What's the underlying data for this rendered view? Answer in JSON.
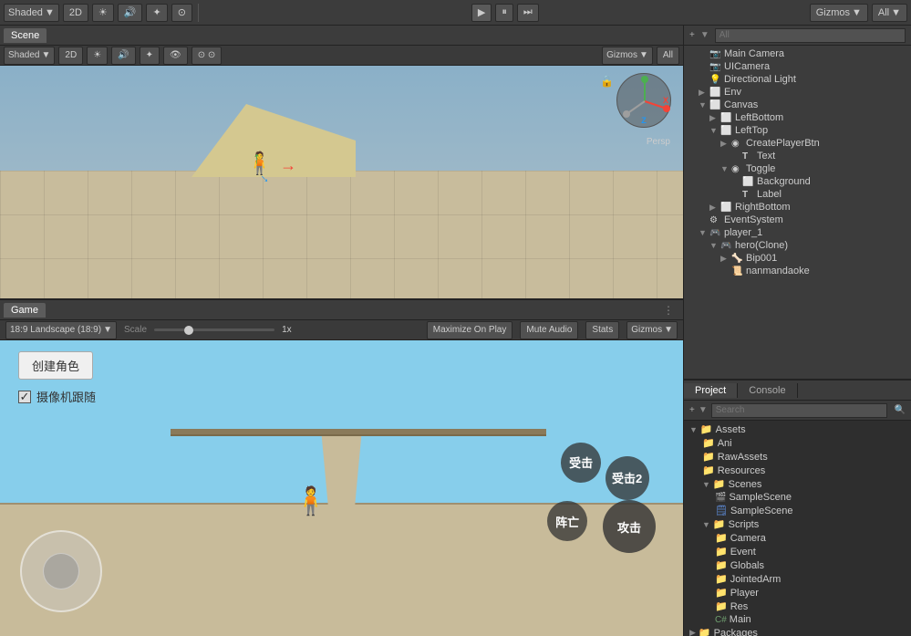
{
  "toolbar": {
    "shading_label": "Shaded",
    "mode_2d": "2D",
    "gizmos_label": "Gizmos",
    "all_label": "All",
    "scene_tab": "Scene",
    "game_tab": "Game"
  },
  "scene_toolbar": {
    "shading": "Shaded",
    "mode": "2D",
    "gizmos": "Gizmos",
    "search": "All"
  },
  "game_toolbar": {
    "aspect": "18:9 Landscape (18:9)",
    "scale_label": "Scale",
    "scale_value": "1x",
    "maximize": "Maximize On Play",
    "mute": "Mute Audio",
    "stats": "Stats",
    "gizmos": "Gizmos"
  },
  "hierarchy": {
    "search_placeholder": "All",
    "items": [
      {
        "label": "Main Camera",
        "indent": 1,
        "icon": "📷",
        "arrow": ""
      },
      {
        "label": "UICamera",
        "indent": 1,
        "icon": "📷",
        "arrow": ""
      },
      {
        "label": "Directional Light",
        "indent": 1,
        "icon": "💡",
        "arrow": ""
      },
      {
        "label": "Env",
        "indent": 1,
        "icon": "🌐",
        "arrow": "▶"
      },
      {
        "label": "Canvas",
        "indent": 1,
        "icon": "▣",
        "arrow": "▼"
      },
      {
        "label": "LeftBottom",
        "indent": 2,
        "icon": "▣",
        "arrow": "▶"
      },
      {
        "label": "LeftTop",
        "indent": 2,
        "icon": "▣",
        "arrow": "▼"
      },
      {
        "label": "CreatePlayerBtn",
        "indent": 3,
        "icon": "◉",
        "arrow": "▶"
      },
      {
        "label": "Text",
        "indent": 4,
        "icon": "T",
        "arrow": ""
      },
      {
        "label": "Toggle",
        "indent": 3,
        "icon": "◉",
        "arrow": "▼"
      },
      {
        "label": "Background",
        "indent": 4,
        "icon": "▣",
        "arrow": ""
      },
      {
        "label": "Label",
        "indent": 4,
        "icon": "T",
        "arrow": ""
      },
      {
        "label": "RightBottom",
        "indent": 2,
        "icon": "▣",
        "arrow": "▶"
      },
      {
        "label": "EventSystem",
        "indent": 1,
        "icon": "⚙",
        "arrow": ""
      },
      {
        "label": "player_1",
        "indent": 1,
        "icon": "🎮",
        "arrow": "▼"
      },
      {
        "label": "hero(Clone)",
        "indent": 2,
        "icon": "🎮",
        "arrow": "▼"
      },
      {
        "label": "Bip001",
        "indent": 3,
        "icon": "🦴",
        "arrow": "▶"
      },
      {
        "label": "nanmandaoke",
        "indent": 3,
        "icon": "📜",
        "arrow": ""
      }
    ]
  },
  "project_console": {
    "project_tab": "Project",
    "console_tab": "Console",
    "folders": [
      {
        "label": "Assets",
        "indent": 0,
        "type": "root_folder",
        "arrow": "▼"
      },
      {
        "label": "Ani",
        "indent": 1,
        "type": "folder",
        "arrow": ""
      },
      {
        "label": "RawAssets",
        "indent": 1,
        "type": "folder",
        "arrow": ""
      },
      {
        "label": "Resources",
        "indent": 1,
        "type": "folder",
        "arrow": ""
      },
      {
        "label": "Scenes",
        "indent": 1,
        "type": "folder",
        "arrow": "▼"
      },
      {
        "label": "SampleScene",
        "indent": 2,
        "type": "scene_unity",
        "arrow": ""
      },
      {
        "label": "SampleScene",
        "indent": 2,
        "type": "scene_file",
        "arrow": ""
      },
      {
        "label": "Scripts",
        "indent": 1,
        "type": "folder",
        "arrow": "▼"
      },
      {
        "label": "Camera",
        "indent": 2,
        "type": "folder",
        "arrow": ""
      },
      {
        "label": "Event",
        "indent": 2,
        "type": "folder",
        "arrow": ""
      },
      {
        "label": "Globals",
        "indent": 2,
        "type": "folder",
        "arrow": ""
      },
      {
        "label": "JointedArm",
        "indent": 2,
        "type": "folder",
        "arrow": ""
      },
      {
        "label": "Player",
        "indent": 2,
        "type": "folder",
        "arrow": ""
      },
      {
        "label": "Res",
        "indent": 2,
        "type": "folder",
        "arrow": ""
      },
      {
        "label": "Main",
        "indent": 2,
        "type": "csharp",
        "arrow": ""
      },
      {
        "label": "Packages",
        "indent": 0,
        "type": "root_folder",
        "arrow": "▶"
      }
    ]
  },
  "game_ui": {
    "create_btn": "创建角色",
    "camera_follow": "摄像机跟随",
    "btn_attack": "攻击",
    "btn_hit2": "受击2",
    "btn_die": "阵亡",
    "btn_hit": "受击"
  },
  "persp_label": "Persp"
}
